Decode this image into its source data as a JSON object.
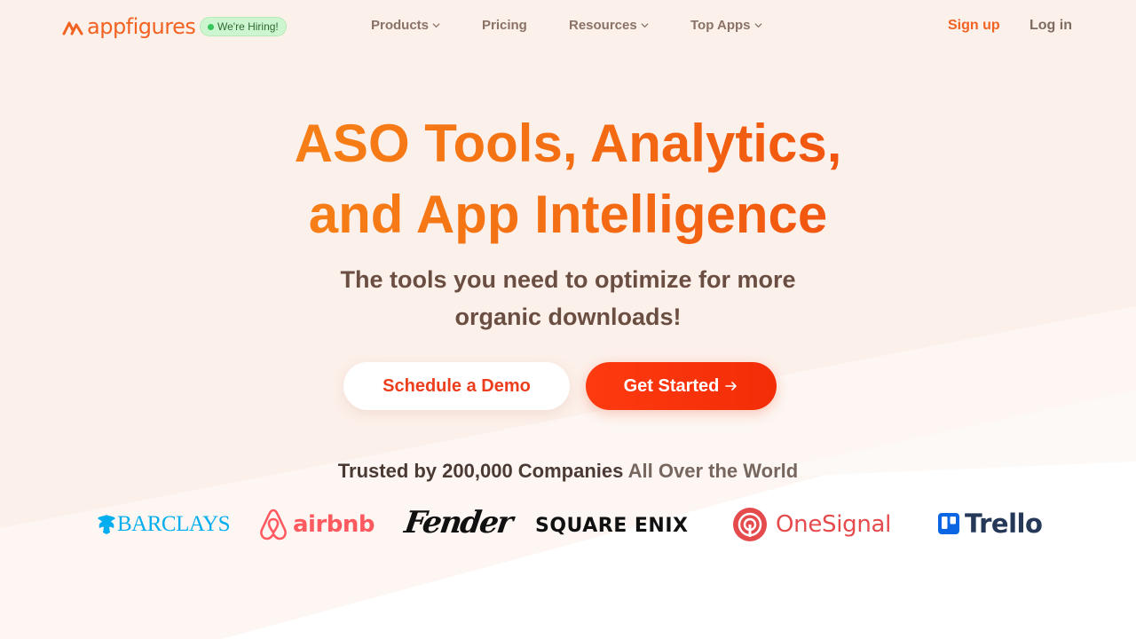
{
  "nav": {
    "logo_text": "appfigures",
    "hiring_badge": "We're Hiring!",
    "items": [
      {
        "label": "Products",
        "dropdown": true
      },
      {
        "label": "Pricing",
        "dropdown": false
      },
      {
        "label": "Resources",
        "dropdown": true
      },
      {
        "label": "Top Apps",
        "dropdown": true
      }
    ],
    "signup": "Sign up",
    "login": "Log in"
  },
  "hero": {
    "title_line1": "ASO Tools, Analytics,",
    "title_line2": "and App Intelligence",
    "subtitle_line1": "The tools you need to optimize for more",
    "subtitle_line2": "organic downloads!",
    "demo_button": "Schedule a Demo",
    "start_button": "Get Started"
  },
  "trusted": {
    "bold": "Trusted by 200,000 Companies",
    "rest": "All Over the World"
  },
  "brands": [
    {
      "name": "BARCLAYS",
      "color": "#00aeef"
    },
    {
      "name": "airbnb",
      "color": "#ff5a5f"
    },
    {
      "name": "Fender",
      "color": "#111111"
    },
    {
      "name": "SQUARE ENIX",
      "color": "#111111"
    },
    {
      "name": "OneSignal",
      "color": "#e54b4d"
    },
    {
      "name": "Trello",
      "color": "#253858"
    }
  ],
  "colors": {
    "accent": "#f26322",
    "background": "#fcf0ea",
    "cta": "#f32d07"
  }
}
